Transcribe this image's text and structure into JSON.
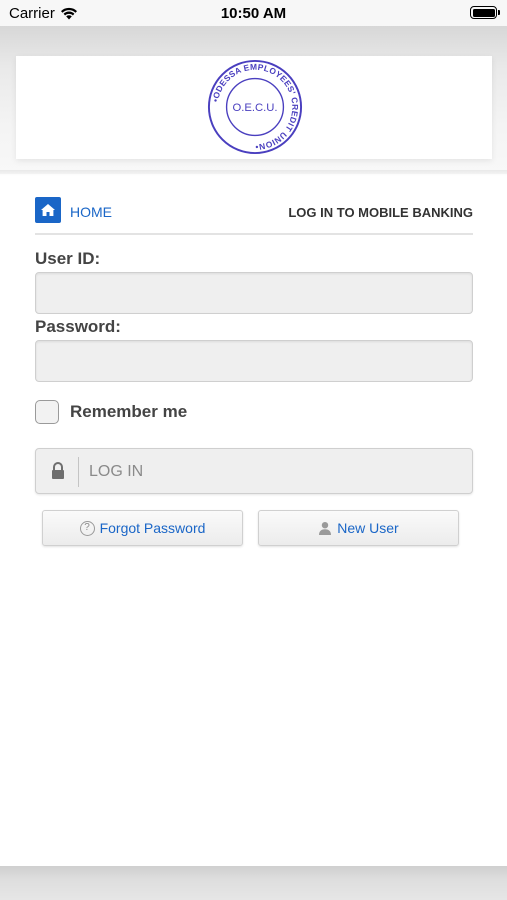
{
  "status_bar": {
    "carrier": "Carrier",
    "time": "10:50 AM",
    "battery_level": 1.0
  },
  "header": {
    "logo": {
      "ring_text": "ODESSA EMPLOYEES' CREDIT UNION",
      "center_text": "O.E.C.U.",
      "color": "#4a3fbf"
    }
  },
  "nav": {
    "home_icon": "home-icon",
    "home_label": "HOME",
    "page_heading": "LOG IN TO MOBILE BANKING"
  },
  "form": {
    "user_id_label": "User ID:",
    "user_id_value": "",
    "password_label": "Password:",
    "password_value": "",
    "remember_label": "Remember me",
    "remember_checked": false,
    "login_icon": "lock-icon",
    "login_label": "LOG IN"
  },
  "links": {
    "forgot_icon": "question-circle-icon",
    "forgot_label": "Forgot Password",
    "new_user_icon": "user-icon",
    "new_user_label": "New User"
  },
  "colors": {
    "accent": "#1a66c7",
    "label": "#444444",
    "input_bg": "#efefef"
  }
}
